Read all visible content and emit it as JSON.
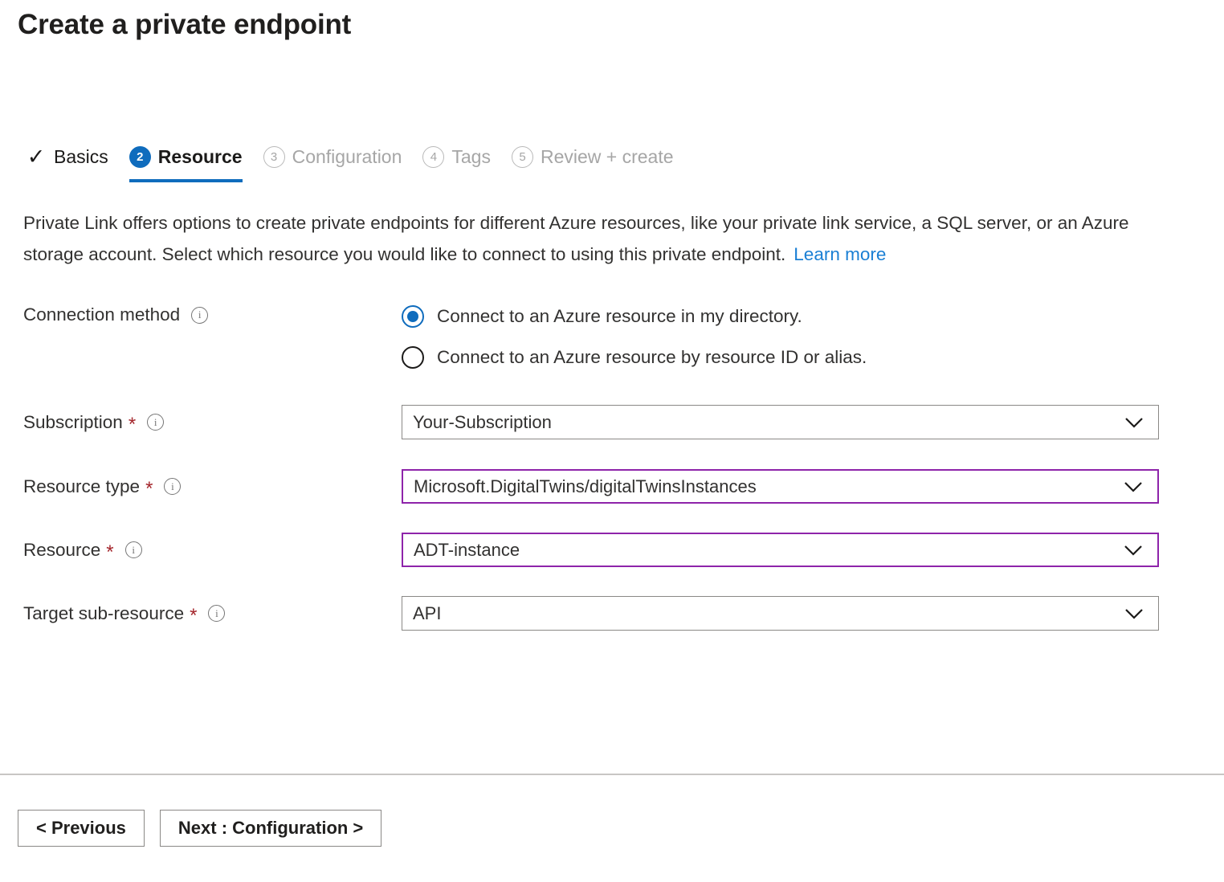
{
  "page": {
    "title": "Create a private endpoint"
  },
  "wizard": {
    "tabs": [
      {
        "badge": "✓",
        "label": "Basics",
        "state": "done"
      },
      {
        "badge": "2",
        "label": "Resource",
        "state": "active"
      },
      {
        "badge": "3",
        "label": "Configuration",
        "state": "pending"
      },
      {
        "badge": "4",
        "label": "Tags",
        "state": "pending"
      },
      {
        "badge": "5",
        "label": "Review + create",
        "state": "pending"
      }
    ],
    "active_accent_color": "#0f6cbd"
  },
  "description": {
    "text": "Private Link offers options to create private endpoints for different Azure resources, like your private link service, a SQL server, or an Azure storage account. Select which resource you would like to connect to using this private endpoint.",
    "learn_more": "Learn more",
    "link_color": "#1a7fd4"
  },
  "form": {
    "connection_method": {
      "label": "Connection method",
      "options": [
        {
          "label": "Connect to an Azure resource in my directory.",
          "checked": true
        },
        {
          "label": "Connect to an Azure resource by resource ID or alias.",
          "checked": false
        }
      ]
    },
    "subscription": {
      "label": "Subscription",
      "required_marker": "*",
      "value": "Your-Subscription",
      "highlighted": false
    },
    "resource_type": {
      "label": "Resource type",
      "required_marker": "*",
      "value": "Microsoft.DigitalTwins/digitalTwinsInstances",
      "highlighted": true
    },
    "resource": {
      "label": "Resource",
      "required_marker": "*",
      "value": "ADT-instance",
      "highlighted": true
    },
    "target_sub_resource": {
      "label": "Target sub-resource",
      "required_marker": "*",
      "value": "API",
      "highlighted": false
    },
    "info_icon_glyph": "i",
    "highlight_border_color": "#8e24aa",
    "required_star_color": "#a4262c"
  },
  "footer": {
    "previous_label": "< Previous",
    "next_label": "Next : Configuration >"
  }
}
